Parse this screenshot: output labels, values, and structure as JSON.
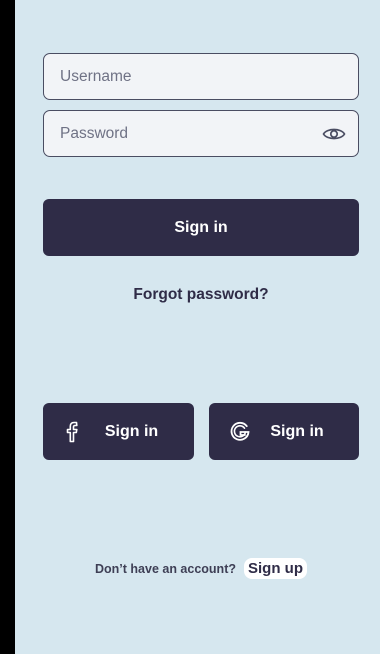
{
  "form": {
    "username_placeholder": "Username",
    "password_placeholder": "Password",
    "signin_label": "Sign in",
    "forgot_label": "Forgot password?"
  },
  "social": {
    "facebook_label": "Sign in",
    "google_label": "Sign in",
    "facebook_icon": "facebook-icon",
    "google_icon": "google-icon"
  },
  "footer": {
    "prompt": "Don’t have an account?",
    "signup_label": "Sign up"
  },
  "colors": {
    "background": "#d6e7ef",
    "primary": "#2f2c47",
    "field_border": "#4a4d62"
  }
}
